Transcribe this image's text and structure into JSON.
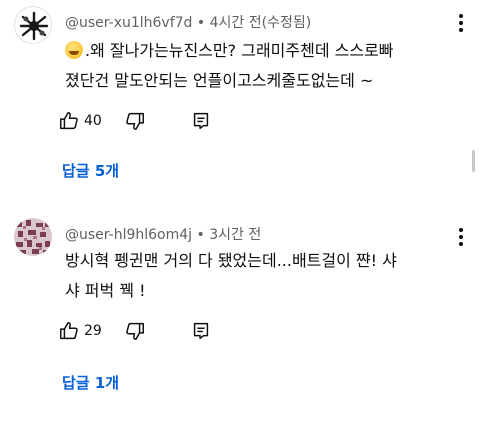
{
  "comments": [
    {
      "username": "@user-xu1lh6vf7d",
      "meta": "• 4시간 전(수정됨)",
      "line1": ".왜 잘나가는뉴진스만? 그래미주첸데 스스로빠",
      "line2": "졌단건 말도안되는 언플이고스케줄도없는데 ~",
      "likes": "40",
      "replies_label": "답글 5개"
    },
    {
      "username": "@user-hl9hl6om4j",
      "meta": "• 3시간 전",
      "line1": "방시혁 펭귄맨 거의 다 됐었는데...배트걸이 쨘! 샤",
      "line2": "샤 퍼벅 꿱 !",
      "likes": "29",
      "replies_label": "답글 1개"
    }
  ],
  "icons": {
    "like": "thumbs-up-icon",
    "dislike": "thumbs-down-icon",
    "reply": "comment-reply-icon",
    "more": "more-vert-icon",
    "emoji": "grinning-sweat-emoji"
  },
  "colors": {
    "link": "#065fd4",
    "meta": "#606060",
    "text": "#0f0f0f"
  }
}
